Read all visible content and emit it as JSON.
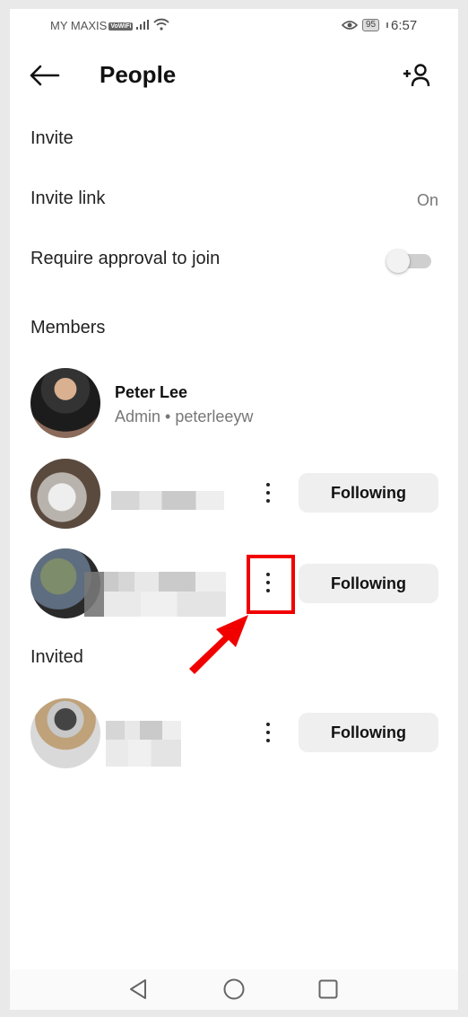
{
  "status_bar": {
    "carrier": "MY MAXIS",
    "volte_badge": "VoWiFi",
    "battery": "95",
    "time": "6:57",
    "icons": [
      "signal-icon",
      "wifi-icon",
      "eye-icon",
      "battery-icon"
    ]
  },
  "app_bar": {
    "title": "People",
    "back_icon": "arrow-left-icon",
    "add_person_icon": "add-person-icon"
  },
  "invite_section": {
    "heading": "Invite",
    "invite_link_label": "Invite link",
    "invite_link_value": "On",
    "require_approval_label": "Require approval to join",
    "require_approval_enabled": false
  },
  "members_section": {
    "heading": "Members",
    "members": [
      {
        "name": "Peter Lee",
        "subtitle": "Admin • peterleeyw",
        "role": "Admin"
      },
      {
        "name": "",
        "name_blurred": true,
        "button": "Following"
      },
      {
        "name": "",
        "name_blurred": true,
        "button": "Following",
        "highlighted_more": true
      }
    ]
  },
  "invited_section": {
    "heading": "Invited",
    "members": [
      {
        "name": "",
        "name_blurred": true,
        "button": "Following"
      }
    ]
  },
  "annotation": {
    "highlight_color": "#f10000",
    "target": "more-options-button"
  },
  "nav_bar": {
    "icons": [
      "nav-back-icon",
      "nav-home-icon",
      "nav-recents-icon"
    ]
  }
}
